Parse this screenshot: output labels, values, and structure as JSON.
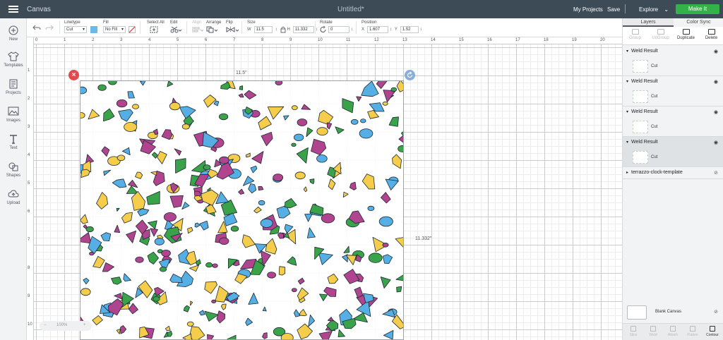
{
  "topbar": {
    "app_title": "Canvas",
    "doc_title": "Untitled*",
    "my_projects": "My Projects",
    "save": "Save",
    "machine": "Explore",
    "make_it": "Make It"
  },
  "leftrail": [
    {
      "label": "New",
      "icon": "plus-circle-icon"
    },
    {
      "label": "Templates",
      "icon": "tshirt-icon"
    },
    {
      "label": "Projects",
      "icon": "projects-icon"
    },
    {
      "label": "Images",
      "icon": "images-icon"
    },
    {
      "label": "Text",
      "icon": "text-icon"
    },
    {
      "label": "Shapes",
      "icon": "shapes-icon"
    },
    {
      "label": "Upload",
      "icon": "upload-icon"
    }
  ],
  "toolbar": {
    "linetype_label": "Linetype",
    "linetype_value": "Cut",
    "fill_label": "Fill",
    "fill_value": "No Fill",
    "fill_color": "#6cb8e6",
    "select_all_label": "Select All",
    "edit_label": "Edit",
    "align_label": "Align",
    "arrange_label": "Arrange",
    "flip_label": "Flip",
    "size_label": "Size",
    "w_label": "W",
    "w_value": "11.5",
    "h_label": "H",
    "h_value": "11.332",
    "rotate_label": "Rotate",
    "rotate_value": "0",
    "position_label": "Position",
    "x_label": "X",
    "x_value": "1.607",
    "y_label": "Y",
    "y_value": "1.52"
  },
  "ruler_top": [
    "0",
    "1",
    "2",
    "3",
    "4",
    "5",
    "6",
    "7",
    "8",
    "9",
    "10",
    "11",
    "12",
    "13",
    "14",
    "15",
    "16",
    "17",
    "18",
    "19",
    "20"
  ],
  "ruler_left": [
    "1",
    "2",
    "3",
    "4",
    "5",
    "6",
    "7",
    "8",
    "9",
    "10"
  ],
  "canvas": {
    "width_dim": "11.5\"",
    "height_dim": "11.332\"",
    "zoom": "100%",
    "zoom_minus": "−",
    "zoom_plus": "+"
  },
  "terrazzo_colors": [
    "#3aa349",
    "#55aee4",
    "#f5cd4b",
    "#b0448f"
  ],
  "rightpanel": {
    "tab_layers": "Layers",
    "tab_color_sync": "Color Sync",
    "tools": [
      {
        "label": "Group",
        "enabled": false
      },
      {
        "label": "UnGroup",
        "enabled": false
      },
      {
        "label": "Duplicate",
        "enabled": true
      },
      {
        "label": "Delete",
        "enabled": true
      }
    ],
    "layers": [
      {
        "name": "Weld Result",
        "sub": "Cut",
        "selected": false
      },
      {
        "name": "Weld Result",
        "sub": "Cut",
        "selected": false
      },
      {
        "name": "Weld Result",
        "sub": "Cut",
        "selected": false
      },
      {
        "name": "Weld Result",
        "sub": "Cut",
        "selected": true
      }
    ],
    "template_layer": "terrazzo-clock-template",
    "blank_canvas": "Blank Canvas",
    "bottom_tools": [
      {
        "label": "Slice",
        "enabled": false
      },
      {
        "label": "Weld",
        "enabled": false
      },
      {
        "label": "Attach",
        "enabled": false
      },
      {
        "label": "Flatten",
        "enabled": false
      },
      {
        "label": "Contour",
        "enabled": true
      }
    ]
  }
}
